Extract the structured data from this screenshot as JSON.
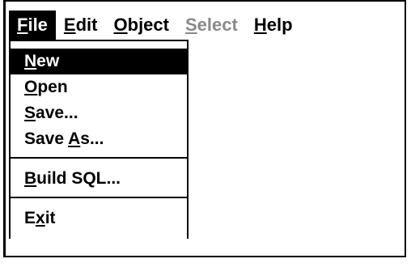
{
  "menubar": {
    "items": [
      {
        "pre": "",
        "mn": "F",
        "post": "ile"
      },
      {
        "pre": "",
        "mn": "E",
        "post": "dit"
      },
      {
        "pre": "",
        "mn": "O",
        "post": "bject"
      },
      {
        "pre": "",
        "mn": "S",
        "post": "elect"
      },
      {
        "pre": "",
        "mn": "H",
        "post": "elp"
      }
    ]
  },
  "file_menu": {
    "items": [
      {
        "pre": "",
        "mn": "N",
        "post": "ew"
      },
      {
        "pre": "",
        "mn": "O",
        "post": "pen"
      },
      {
        "pre": "",
        "mn": "S",
        "post": "ave..."
      },
      {
        "pre": "Save ",
        "mn": "A",
        "post": "s..."
      },
      {
        "pre": "",
        "mn": "B",
        "post": "uild SQL..."
      },
      {
        "pre": "E",
        "mn": "x",
        "post": "it"
      }
    ]
  }
}
